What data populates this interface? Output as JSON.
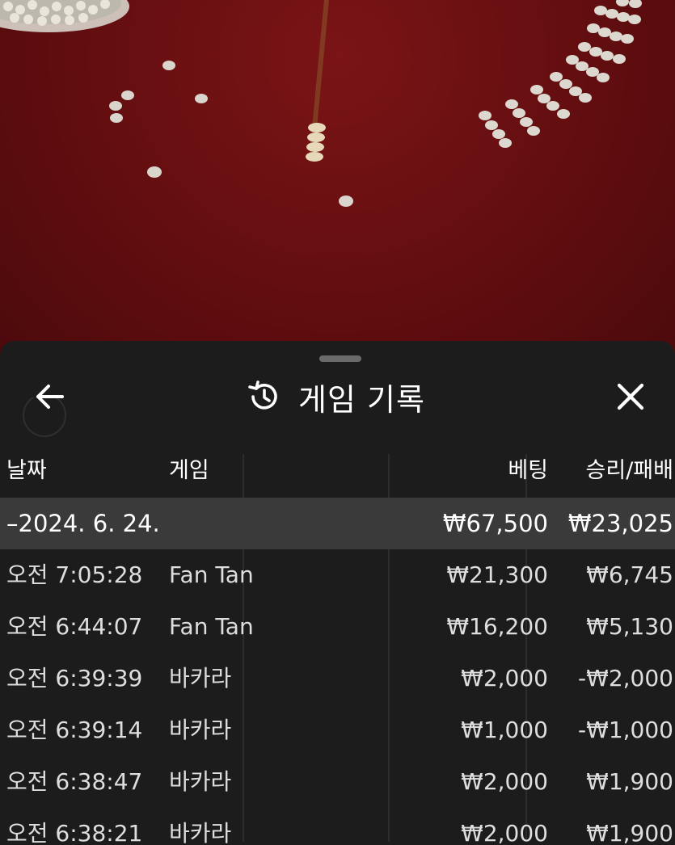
{
  "sheet": {
    "title": "게임 기록"
  },
  "icons": {
    "back": "arrow-left-icon",
    "history": "history-clock-icon",
    "close": "close-x-icon"
  },
  "colors": {
    "table_felt": "#6b1012",
    "sheet_bg": "#1c1c1c",
    "group_row_bg": "#3a3a3a",
    "text": "#ffffff"
  },
  "table": {
    "headers": {
      "date": "날짜",
      "game": "게임",
      "bet": "베팅",
      "win_loss": "승리/패배"
    },
    "group": {
      "date": "–2024. 6. 24.",
      "bet": "₩67,500",
      "win_loss": "₩23,025"
    },
    "rows": [
      {
        "time": "오전 7:05:28",
        "game": "Fan Tan",
        "bet": "₩21,300",
        "win_loss": "₩6,745"
      },
      {
        "time": "오전 6:44:07",
        "game": "Fan Tan",
        "bet": "₩16,200",
        "win_loss": "₩5,130"
      },
      {
        "time": "오전 6:39:39",
        "game": "바카라",
        "bet": "₩2,000",
        "win_loss": "-₩2,000"
      },
      {
        "time": "오전 6:39:14",
        "game": "바카라",
        "bet": "₩1,000",
        "win_loss": "-₩1,000"
      },
      {
        "time": "오전 6:38:47",
        "game": "바카라",
        "bet": "₩2,000",
        "win_loss": "₩1,900"
      },
      {
        "time": "오전 6:38:21",
        "game": "바카라",
        "bet": "₩2,000",
        "win_loss": "₩1,900"
      }
    ]
  }
}
